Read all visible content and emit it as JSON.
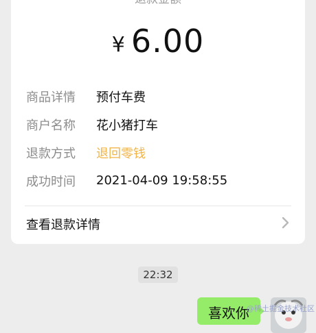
{
  "refund": {
    "label": "退款金额",
    "currency_symbol": "¥",
    "amount": "6.00"
  },
  "details": [
    {
      "key": "商品详情",
      "value": "预付车费",
      "highlight": false
    },
    {
      "key": "商户名称",
      "value": "花小猪打车",
      "highlight": false
    },
    {
      "key": "退款方式",
      "value": "退回零钱",
      "highlight": true
    },
    {
      "key": "成功时间",
      "value": "2021-04-09 19:58:55",
      "highlight": false
    }
  ],
  "view_details_label": "查看退款详情",
  "chat": {
    "timestamp": "22:32",
    "message": "喜欢你",
    "watermark": "@稀土掘金技术社区"
  },
  "colors": {
    "background": "#ededed",
    "card": "#ffffff",
    "highlight": "#f2b447",
    "bubble": "#95ec69"
  },
  "icons": {
    "detail_chevron": "chevron-right-icon",
    "avatar": "avatar-image"
  }
}
